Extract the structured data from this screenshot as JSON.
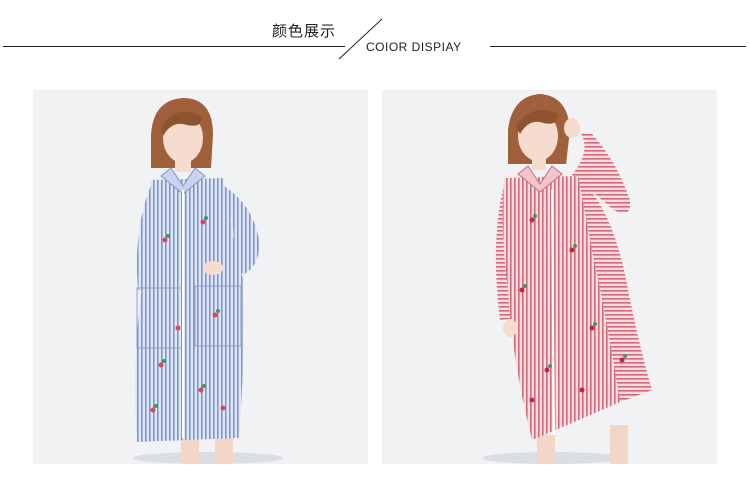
{
  "header": {
    "title_cn": "颜色展示",
    "title_en": "COIOR DISPIAY"
  },
  "products": [
    {
      "color_name": "blue-stripe",
      "stripe_color": "#7f95c9",
      "dress_color": "#b8c6ea"
    },
    {
      "color_name": "red-stripe",
      "stripe_color": "#cf6b7b",
      "dress_color": "#eab3bb"
    }
  ]
}
